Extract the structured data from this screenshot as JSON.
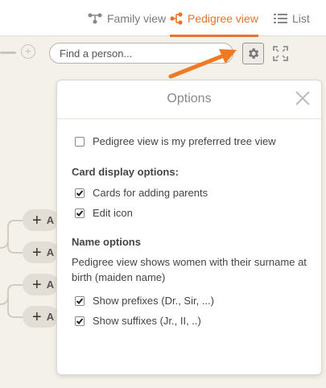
{
  "tabs": [
    {
      "label": "Family view",
      "icon": "family-tree-icon",
      "active": false
    },
    {
      "label": "Pedigree view",
      "icon": "pedigree-tree-icon",
      "active": true
    },
    {
      "label": "List",
      "icon": "list-icon",
      "active": false
    }
  ],
  "search": {
    "placeholder": "Find a person..."
  },
  "tree": {
    "card_label": "A"
  },
  "options": {
    "title": "Options",
    "preferred_view": {
      "label": "Pedigree view is my preferred tree view",
      "checked": false
    },
    "card_display": {
      "title": "Card display options:",
      "items": [
        {
          "label": "Cards for adding parents",
          "checked": true
        },
        {
          "label": "Edit icon",
          "checked": true
        }
      ]
    },
    "name_options": {
      "title": "Name options",
      "description": "Pedigree view shows women with their surname at birth (maiden name)",
      "items": [
        {
          "label": "Show prefixes (Dr., Sir, ...)",
          "checked": true
        },
        {
          "label": "Show suffixes (Jr., II, ..)",
          "checked": true
        }
      ]
    }
  },
  "colors": {
    "accent": "#e8742b",
    "background": "#f4f0ea",
    "arrow": "#f07a23"
  }
}
